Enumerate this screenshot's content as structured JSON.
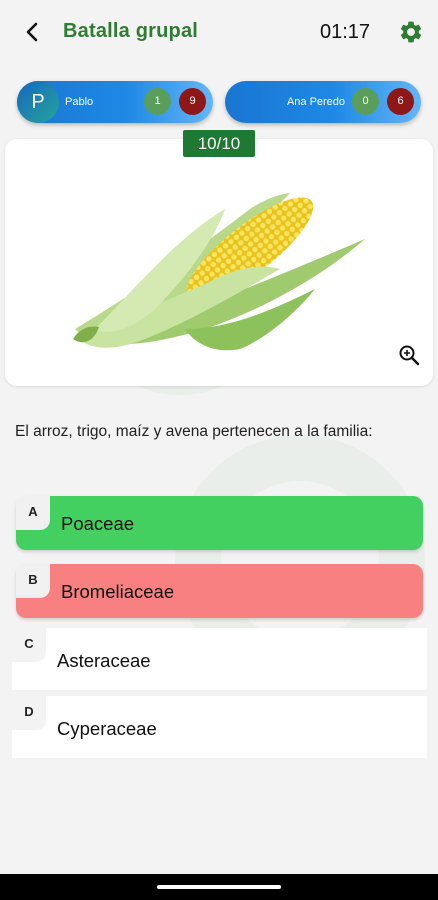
{
  "header": {
    "title": "Batalla grupal",
    "timer": "01:17",
    "back_icon": "arrow-left-icon",
    "settings_icon": "gear-icon"
  },
  "players": [
    {
      "initial": "P",
      "name": "Pablo",
      "correct": "1",
      "wrong": "9"
    },
    {
      "initial": "",
      "name": "Ana Peredo",
      "correct": "0",
      "wrong": "6"
    }
  ],
  "progress": "10/10",
  "image": {
    "subject": "corn-cob",
    "zoom_icon": "zoom-in-icon"
  },
  "question": "El arroz, trigo, maíz y avena pertenecen a la familia:",
  "options": [
    {
      "letter": "A",
      "text": "Poaceae",
      "state": "correct"
    },
    {
      "letter": "B",
      "text": "Bromeliaceae",
      "state": "wrong"
    },
    {
      "letter": "C",
      "text": "Asteraceae",
      "state": "neutral"
    },
    {
      "letter": "D",
      "text": "Cyperaceae",
      "state": "neutral"
    }
  ],
  "colors": {
    "brand_green": "#2e7d32",
    "correct": "#43d061",
    "wrong": "#f88080",
    "player_blue": "#1e88e5"
  }
}
